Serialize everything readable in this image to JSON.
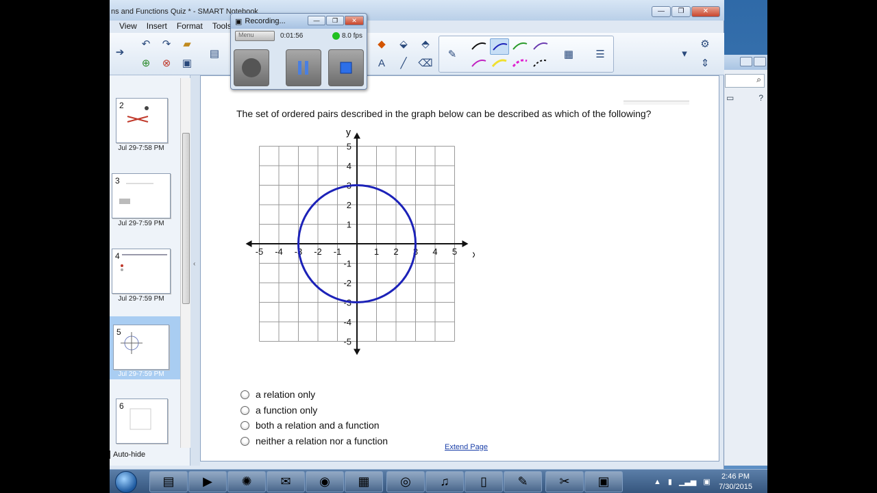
{
  "window": {
    "title": "ns and Functions Quiz * - SMART Notebook",
    "min": "—",
    "max": "❐",
    "close": "✕"
  },
  "menu": [
    "View",
    "Insert",
    "Format",
    "Tools"
  ],
  "recorder": {
    "title": "Recording...",
    "menu_label": "Menu",
    "elapsed": "0:01:56",
    "fps": "8.0 fps"
  },
  "sidebar": {
    "thumbs": [
      {
        "num": "2",
        "date": "Jul 29-7:58 PM"
      },
      {
        "num": "3",
        "date": "Jul 29-7:59 PM"
      },
      {
        "num": "4",
        "date": "Jul 29-7:59 PM"
      },
      {
        "num": "5",
        "date": "Jul 29-7:59 PM"
      },
      {
        "num": "6",
        "date": ""
      }
    ],
    "autohide": "Auto-hide"
  },
  "page": {
    "question": "The set of ordered pairs described in the graph below can be described as which of the following?",
    "choices": [
      "a relation only",
      "a function only",
      "both a relation and a function",
      "neither a relation nor a function"
    ],
    "extend": "Extend Page"
  },
  "chart_data": {
    "type": "scatter",
    "shape": "circle",
    "center": [
      0,
      0
    ],
    "radius": 3,
    "xlabel": "x",
    "ylabel": "y",
    "xlim": [
      -5,
      5
    ],
    "ylim": [
      -5,
      5
    ],
    "x_ticks": [
      "-5",
      "-4",
      "-3",
      "-2",
      "-1",
      "1",
      "2",
      "3",
      "4",
      "5"
    ],
    "y_ticks": [
      "5",
      "4",
      "3",
      "2",
      "1",
      "-1",
      "-2",
      "-3",
      "-4",
      "-5"
    ],
    "grid": true,
    "color": "#1c22b8"
  },
  "taskbar": {
    "time": "2:46 PM",
    "date": "7/30/2015"
  }
}
